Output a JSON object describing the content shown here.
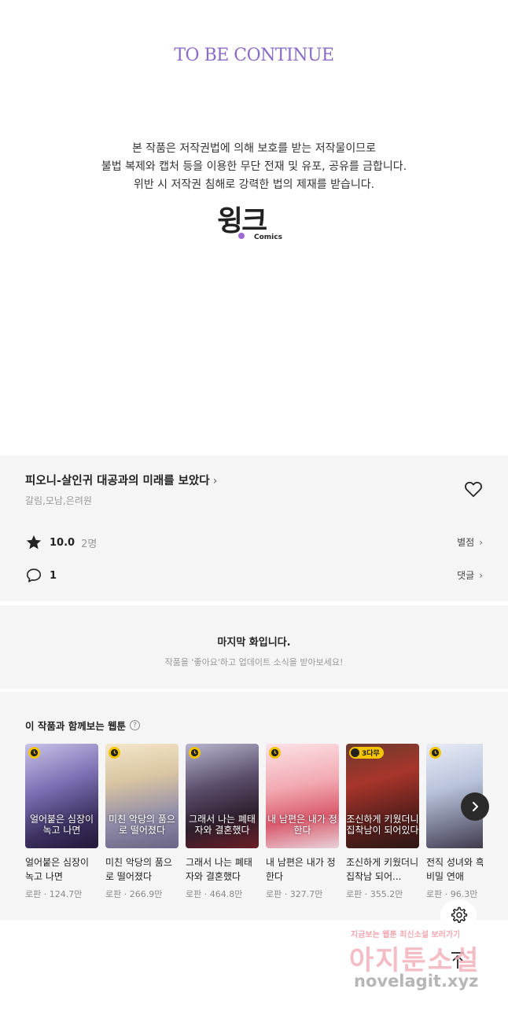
{
  "ending": {
    "title": "TO BE CONTINUE",
    "notice_line1": "본 작품은 저작권법에 의해 보호를 받는 저작물이므로",
    "notice_line2": "불법 복제와 캡처 등을 이용한 무단 전재 및 유포, 공유를 금합니다.",
    "notice_line3": "위반 시 저작권 침해로 강력한 법의 제재를 받습니다.",
    "logo_word": "윙크",
    "logo_sub": "Comics"
  },
  "series": {
    "title": "피오니-살인귀 대공과의 미래를 보았다",
    "tags": "갈림,모남,은려원",
    "rating": "10.0",
    "rating_count": "2명",
    "rating_link": "별점",
    "comment_count": "1",
    "comment_link": "댓글"
  },
  "last_episode": {
    "heading": "마지막 화입니다.",
    "sub": "작품을 '좋아요'하고 업데이트 소식을 받아보세요!"
  },
  "recommend": {
    "heading": "이 작품과 함께보는 웹툰",
    "help": "?",
    "items": [
      {
        "title": "얼어붙은 심장이 녹고 나면",
        "meta": "로판 · 124.7만",
        "cover": "얼어붙은 심장이 녹고 나면",
        "badge": ""
      },
      {
        "title": "미친 악당의 품으로 떨어졌다",
        "meta": "로판 · 266.9만",
        "cover": "미친 악당의 품으로 떨어졌다",
        "badge": ""
      },
      {
        "title": "그래서 나는 폐태자와 결혼했다",
        "meta": "로판 · 464.8만",
        "cover": "그래서 나는 폐태자와 결혼했다",
        "badge": ""
      },
      {
        "title": "내 남편은 내가 정한다",
        "meta": "로판 · 327.7만",
        "cover": "내 남편은 내가 정한다",
        "badge": ""
      },
      {
        "title": "조신하게 키웠더니 집착남 되어...",
        "meta": "로판 · 355.2만",
        "cover": "조신하게 키웠더니 집착남이 되어있다",
        "badge": "3다무"
      },
      {
        "title": "전직 성녀와 흑의 비밀 연애",
        "meta": "로판 · 96.3만",
        "cover": "",
        "badge": ""
      }
    ]
  },
  "watermark": {
    "line1": "지금보는 웹툰 최신소설 보러가기",
    "line2": "아지툰소설",
    "line3": "novelagit.xyz"
  },
  "colors": {
    "accent_purple": "#8a6cc7",
    "panel_bg": "#f5f5f5",
    "badge_yellow": "#f5c400"
  },
  "icons": [
    "heart-icon",
    "star-icon",
    "comment-icon",
    "question-icon",
    "clock-icon",
    "chevron-right-icon",
    "gear-icon",
    "arrow-up-icon"
  ]
}
